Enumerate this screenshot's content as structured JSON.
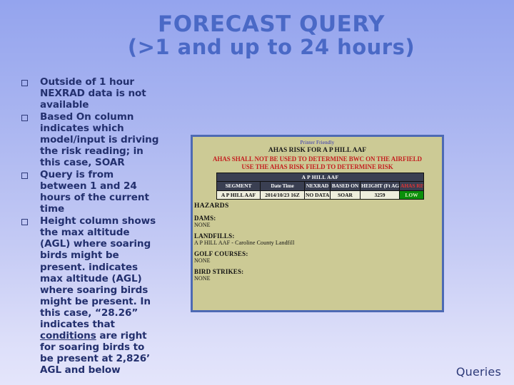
{
  "slide": {
    "title_line1": "FORECAST QUERY",
    "title_line2": "(>1 and up to 24 hours)",
    "footer": "Queries",
    "colors": {
      "background_top": "#94a4ee",
      "background_bottom": "#e4e5fb",
      "title_color": "#4a69c6",
      "body_text_color": "#23306e",
      "panel_border": "#4d6ab4",
      "panel_background": "#ccca95",
      "warning_red": "#c42020",
      "risk_low_green": "#0b8f0b",
      "table_header_dark": "#3a3f52"
    }
  },
  "bullets": [
    {
      "marker": "hollow-square",
      "text": "Outside of 1 hour NEXRAD data is not available"
    },
    {
      "marker": "hollow-square",
      "text": "Based On column indicates which model/input is driving the risk reading; in this case, SOAR"
    },
    {
      "marker": "hollow-square",
      "text": "Query is from between 1 and 24 hours of the current time"
    },
    {
      "marker": "hollow-square",
      "text_parts": [
        "Height column shows the max altitude (AGL) where soaring birds might be present. indicates max altitude (AGL) where soaring birds might be present.  In this case, “28.26” indicates that ",
        "conditions",
        " are right for soaring birds to be present at 2,826’ AGL and below"
      ]
    }
  ],
  "ahas_panel": {
    "printer_friendly_link": "Printer Friendly",
    "heading": "AHAS RISK FOR A P HILL AAF",
    "warning_line1": "AHAS SHALL NOT BE USED TO DETERMINE BWC ON THE AIRFIELD",
    "warning_line2": "USE THE AHAS RISK FIELD TO DETERMINE RISK",
    "table": {
      "caption": "A P HILL AAF",
      "headers": [
        "SEGMENT",
        "Date Time",
        "NEXRAD",
        "BASED ON",
        "HEIGHT (Ft AGL)",
        "AHAS RISK"
      ],
      "rows": [
        {
          "segment": "A P HILL AAF",
          "date_time": "2014/10/23 16Z",
          "nexrad": "NO DATA",
          "based_on": "SOAR",
          "height_ft_agl": "3259",
          "ahas_risk": "LOW"
        }
      ]
    },
    "hazards": {
      "title": "HAZARDS",
      "groups": [
        {
          "label": "DAMS:",
          "value": "NONE"
        },
        {
          "label": "LANDFILLS:",
          "value": "A P HILL AAF - Caroline County Landfill"
        },
        {
          "label": "GOLF COURSES:",
          "value": "NONE"
        },
        {
          "label": "BIRD STRIKES:",
          "value": "NONE"
        }
      ]
    }
  }
}
